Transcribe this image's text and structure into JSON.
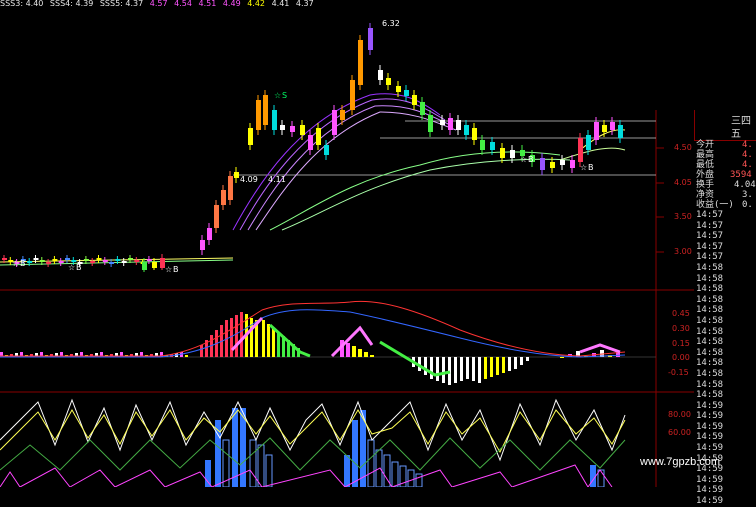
{
  "ma_header": [
    {
      "text": "SSS3: 4.40",
      "color": "#e8e8e8"
    },
    {
      "text": "SSS4: 4.39",
      "color": "#e8e8e8"
    },
    {
      "text": "SSS5: 4.37",
      "color": "#e8e8e8"
    },
    {
      "text": "4.57",
      "color": "#ff55ff"
    },
    {
      "text": "4.54",
      "color": "#ff55ff"
    },
    {
      "text": "4.51",
      "color": "#ff55ff"
    },
    {
      "text": "4.49",
      "color": "#ff55ff"
    },
    {
      "text": "4.42",
      "color": "#ffff00"
    },
    {
      "text": "4.41",
      "color": "#e8e8e8"
    },
    {
      "text": "4.37",
      "color": "#e8e8e8"
    }
  ],
  "price_axis": [
    "4.50",
    "4.05",
    "3.50",
    "3.00"
  ],
  "macd_axis": [
    "0.45",
    "0.30",
    "0.15",
    "0.00",
    "-0.15"
  ],
  "kdj_axis": [
    "80.00",
    "60.00"
  ],
  "annotations": {
    "high_price": "6.32",
    "range_low": "4.09",
    "range_high": "4.11",
    "buy_marker": "B",
    "sell_marker": "S",
    "star": "☆"
  },
  "quote_panel": {
    "header_chars": [
      "三",
      "四",
      "五"
    ],
    "rows": [
      {
        "label": "今开",
        "value": "4."
      },
      {
        "label": "最高",
        "value": "4."
      },
      {
        "label": "最低",
        "value": "4."
      },
      {
        "label": "外盘",
        "value": "3594"
      },
      {
        "label": "换手",
        "value": "4.04"
      },
      {
        "label": "净资",
        "value": "3."
      },
      {
        "label": "收益(一)",
        "value": "0."
      }
    ]
  },
  "time_list": [
    "14:57",
    "14:57",
    "14:57",
    "14:57",
    "14:57",
    "14:58",
    "14:58",
    "14:58",
    "14:58",
    "14:58",
    "14:58",
    "14:58",
    "14:58",
    "14:58",
    "14:58",
    "14:58",
    "14:58",
    "14:58",
    "14:59",
    "14:59",
    "14:59",
    "14:59",
    "14:59",
    "14:59",
    "14:59",
    "14:59",
    "14:59",
    "14:59"
  ],
  "watermark": "www.7gpzb.com",
  "colors": {
    "up": "#ff3355",
    "down": "#00dddd",
    "yellow": "#ffff00",
    "magenta": "#ff55ff",
    "axis": "#880000"
  }
}
